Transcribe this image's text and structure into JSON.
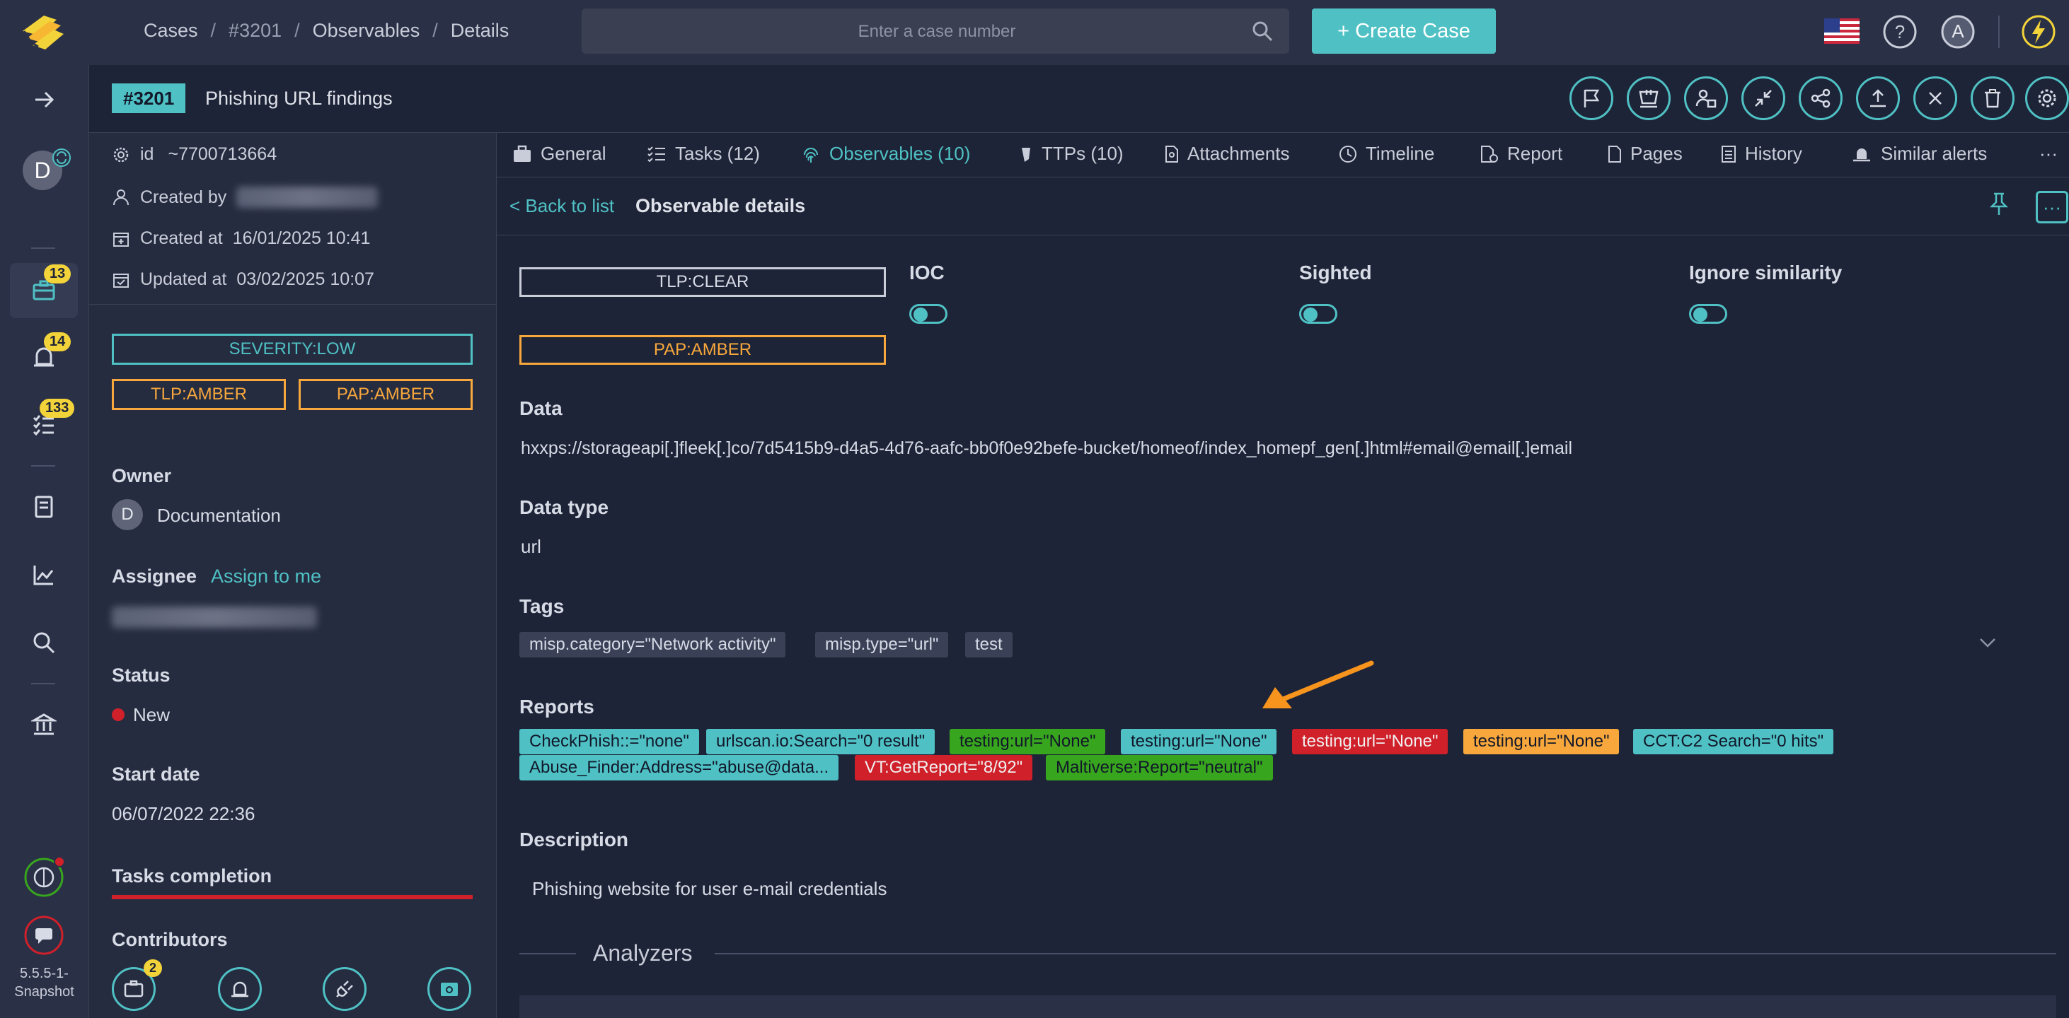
{
  "breadcrumb": {
    "cases": "Cases",
    "case_id": "#3201",
    "observables": "Observables",
    "details": "Details",
    "sep": "/"
  },
  "search": {
    "placeholder": "Enter a case number"
  },
  "create_case": {
    "label": "Create Case",
    "plus": "+"
  },
  "user": {
    "avatar_letter": "A",
    "nav_avatar_letter": "D"
  },
  "nav": {
    "cases_badge": "13",
    "alerts_badge": "14",
    "tasks_badge": "133",
    "version": "5.5.5-1-Snapshot"
  },
  "case": {
    "number": "#3201",
    "title": "Phishing URL findings"
  },
  "meta": {
    "id_label": "id",
    "id_value": "~7700713664",
    "created_by_label": "Created by",
    "created_at_label": "Created at",
    "created_at_value": "16/01/2025 10:41",
    "updated_at_label": "Updated at",
    "updated_at_value": "03/02/2025 10:07"
  },
  "case_tags": {
    "severity": "SEVERITY:LOW",
    "tlp": "TLP:AMBER",
    "pap": "PAP:AMBER"
  },
  "owner": {
    "label": "Owner",
    "avatar": "D",
    "name": "Documentation"
  },
  "assignee": {
    "label": "Assignee",
    "assign_link": "Assign to me"
  },
  "status": {
    "label": "Status",
    "value": "New"
  },
  "start_date": {
    "label": "Start date",
    "value": "06/07/2022 22:36"
  },
  "tasks_completion": {
    "label": "Tasks completion"
  },
  "contributors": {
    "label": "Contributors"
  },
  "bottom": {
    "cases_badge": "2"
  },
  "tabs": [
    {
      "label": "General"
    },
    {
      "label": "Tasks (12)"
    },
    {
      "label": "Observables (10)"
    },
    {
      "label": "TTPs (10)"
    },
    {
      "label": "Attachments"
    },
    {
      "label": "Timeline"
    },
    {
      "label": "Report"
    },
    {
      "label": "Pages"
    },
    {
      "label": "History"
    },
    {
      "label": "Similar alerts"
    }
  ],
  "tabs_more": "···",
  "observable": {
    "back_link": "< Back to list",
    "title": "Observable details",
    "tlp": "TLP:CLEAR",
    "pap": "PAP:AMBER",
    "ioc_label": "IOC",
    "sighted_label": "Sighted",
    "ignore_label": "Ignore similarity",
    "data_label": "Data",
    "data_value": "hxxps://storageapi[.]fleek[.]co/7d5415b9-d4a5-4d76-aafc-bb0f0e92befe-bucket/homeof/index_homepf_gen[.]html#email@email[.]email",
    "data_type_label": "Data type",
    "data_type_value": "url",
    "tags_label": "Tags",
    "tags": [
      "misp.category=\"Network activity\"",
      "misp.type=\"url\"",
      "test"
    ],
    "reports_label": "Reports",
    "reports": [
      {
        "text": "CheckPhish::=\"none\"",
        "color": "teal"
      },
      {
        "text": "urlscan.io:Search=\"0 result\"",
        "color": "teal"
      },
      {
        "text": "testing:url=\"None\"",
        "color": "green"
      },
      {
        "text": "testing:url=\"None\"",
        "color": "teal"
      },
      {
        "text": "testing:url=\"None\"",
        "color": "red"
      },
      {
        "text": "testing:url=\"None\"",
        "color": "orange"
      },
      {
        "text": "CCT:C2 Search=\"0 hits\"",
        "color": "teal"
      },
      {
        "text": "Abuse_Finder:Address=\"abuse@data...",
        "color": "teal"
      },
      {
        "text": "VT:GetReport=\"8/92\"",
        "color": "red"
      },
      {
        "text": "Maltiverse:Report=\"neutral\"",
        "color": "green"
      }
    ],
    "description_label": "Description",
    "description_value": "Phishing website for user e-mail credentials",
    "analyzers_label": "Analyzers"
  },
  "colors": {
    "accent": "#4fc1c4",
    "amber": "#f7a73c",
    "red": "#d0202a",
    "green": "#38a51e",
    "yellow": "#f3d33a"
  }
}
